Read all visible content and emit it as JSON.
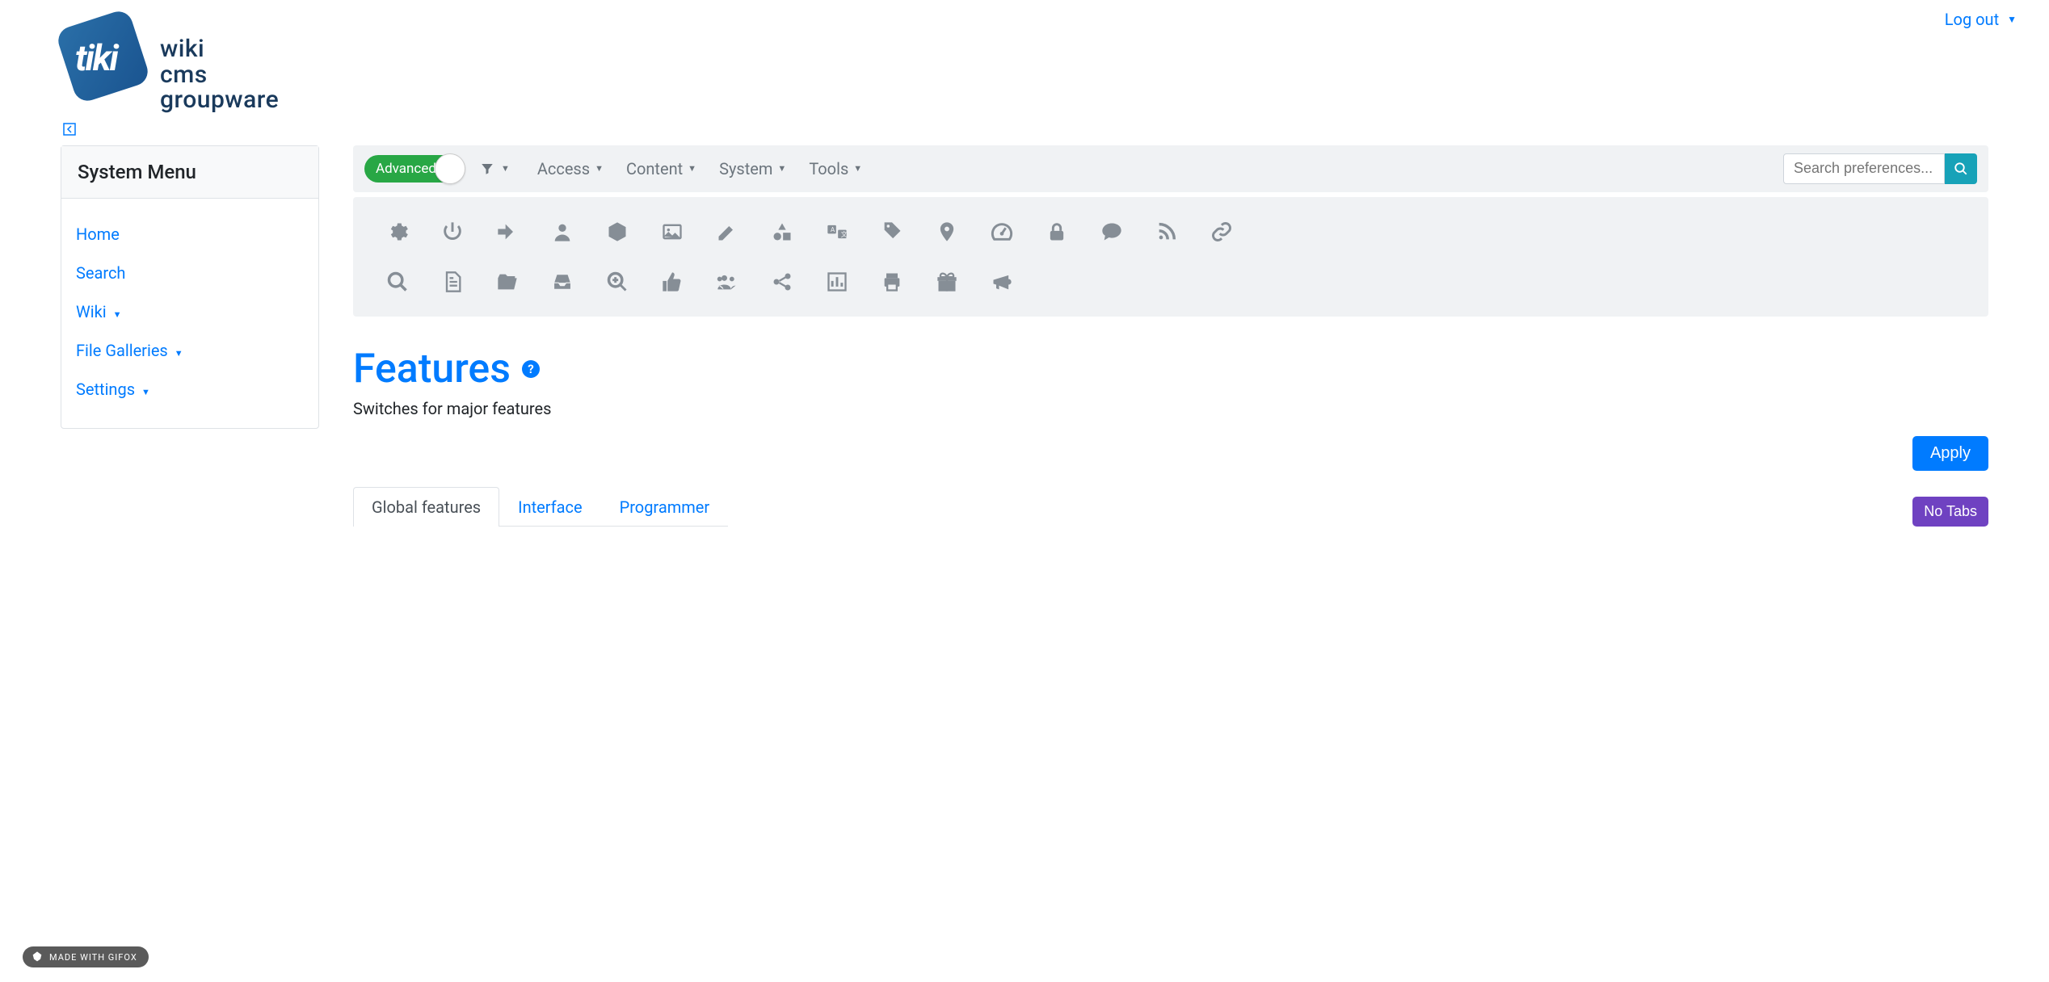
{
  "header": {
    "logo_text_lines": "wiki\ncms\ngroupware",
    "logout": "Log out"
  },
  "sidebar": {
    "title": "System Menu",
    "items": [
      {
        "label": "Home",
        "has_caret": false
      },
      {
        "label": "Search",
        "has_caret": false
      },
      {
        "label": "Wiki",
        "has_caret": true
      },
      {
        "label": "File Galleries",
        "has_caret": true
      },
      {
        "label": "Settings",
        "has_caret": true
      }
    ]
  },
  "toolbar": {
    "toggle_label": "Advanced",
    "nav": [
      {
        "label": "Access"
      },
      {
        "label": "Content"
      },
      {
        "label": "System"
      },
      {
        "label": "Tools"
      }
    ],
    "search_placeholder": "Search preferences..."
  },
  "icon_panel": {
    "row1": [
      "gear-icon",
      "power-icon",
      "signin-icon",
      "user-icon",
      "package-icon",
      "image-icon",
      "edit-icon",
      "shapes-icon",
      "translate-icon",
      "tag-icon",
      "map-pin-icon",
      "dashboard-icon",
      "lock-icon",
      "comment-icon",
      "rss-icon",
      "link-icon"
    ],
    "row2": [
      "search-icon",
      "document-icon",
      "folder-open-icon",
      "inbox-icon",
      "zoom-in-icon",
      "thumbs-up-icon",
      "users-icon",
      "share-icon",
      "bar-chart-icon",
      "print-icon",
      "gift-icon",
      "megaphone-icon"
    ]
  },
  "page": {
    "title": "Features",
    "subtitle": "Switches for major features",
    "apply_label": "Apply",
    "notabs_label": "No Tabs",
    "tabs": [
      {
        "label": "Global features",
        "active": true
      },
      {
        "label": "Interface",
        "active": false
      },
      {
        "label": "Programmer",
        "active": false
      }
    ]
  },
  "badge": {
    "text": "MADE WITH GIFOX"
  }
}
